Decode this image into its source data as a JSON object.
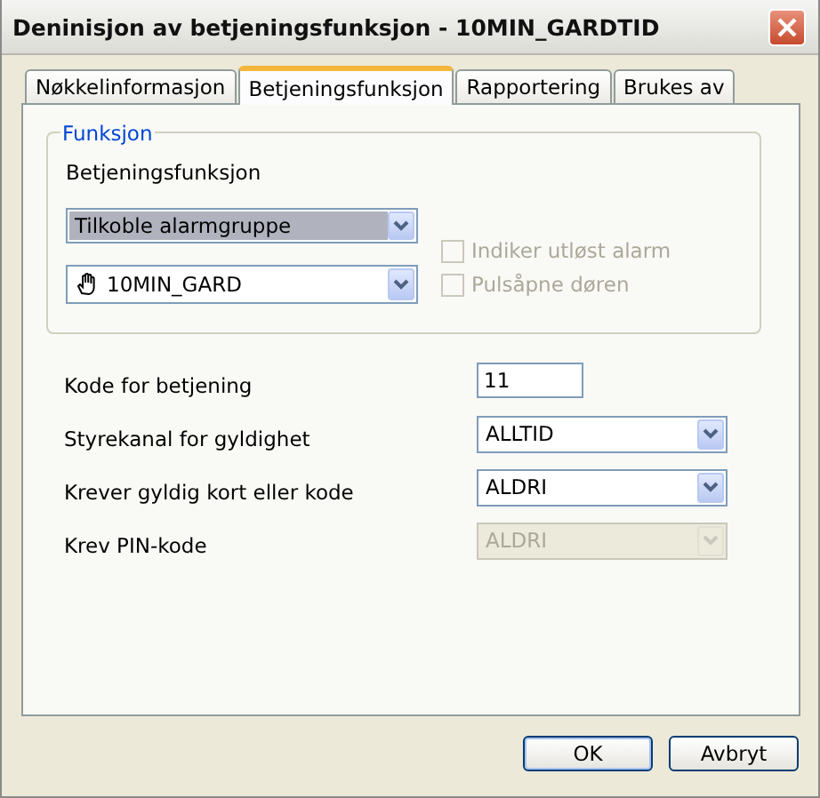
{
  "window": {
    "title": "Deninisjon av betjeningsfunksjon - 10MIN_GARDTID"
  },
  "tabs": [
    {
      "label": "Nøkkelinformasjon",
      "selected": false
    },
    {
      "label": "Betjeningsfunksjon",
      "selected": true
    },
    {
      "label": "Rapportering",
      "selected": false
    },
    {
      "label": "Brukes av",
      "selected": false
    }
  ],
  "group": {
    "title": "Funksjon",
    "label": "Betjeningsfunksjon",
    "combos": [
      {
        "value": "Tilkoble alarmgruppe",
        "highlighted": true,
        "icon": false
      },
      {
        "value": "10MIN_GARD",
        "highlighted": false,
        "icon": true
      }
    ],
    "checkboxes": [
      {
        "label": "Indiker utløst alarm",
        "checked": false,
        "disabled": true
      },
      {
        "label": "Pulsåpne døren",
        "checked": false,
        "disabled": true
      }
    ]
  },
  "fields": [
    {
      "label": "Kode for betjening",
      "kind": "text",
      "value": "11",
      "disabled": false
    },
    {
      "label": "Styrekanal for gyldighet",
      "kind": "select",
      "value": "ALLTID",
      "disabled": false
    },
    {
      "label": "Krever gyldig kort eller kode",
      "kind": "select",
      "value": "ALDRI",
      "disabled": false
    },
    {
      "label": "Krev PIN-kode",
      "kind": "select",
      "value": "ALDRI",
      "disabled": true
    }
  ],
  "buttons": [
    "OK",
    "Avbryt"
  ]
}
